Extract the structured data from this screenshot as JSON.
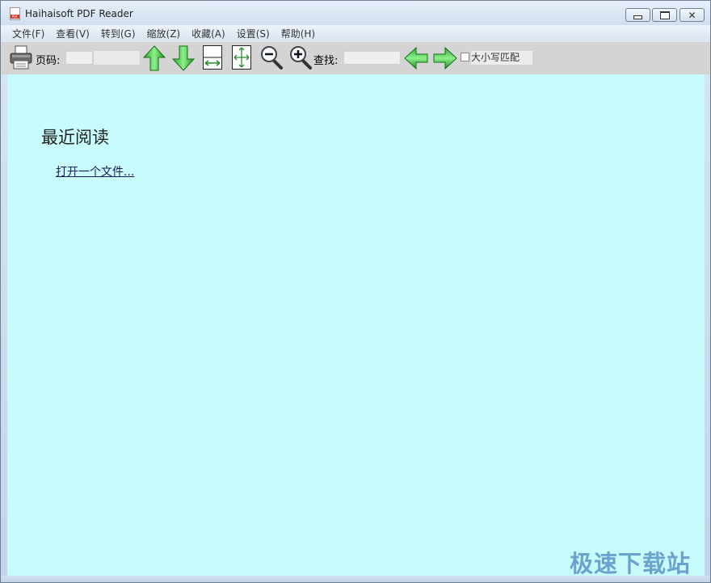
{
  "window": {
    "title": "Haihaisoft PDF Reader",
    "minimize_label": "",
    "maximize_label": "",
    "close_label": "✕"
  },
  "menu": {
    "items": [
      {
        "label": "文件(F)"
      },
      {
        "label": "查看(V)"
      },
      {
        "label": "转到(G)"
      },
      {
        "label": "缩放(Z)"
      },
      {
        "label": "收藏(A)"
      },
      {
        "label": "设置(S)"
      },
      {
        "label": "帮助(H)"
      }
    ]
  },
  "toolbar": {
    "page_label": "页码:",
    "page_value": "",
    "find_label": "查找:",
    "find_value": "",
    "case_match_label": "大小写匹配",
    "case_match_checked": false,
    "icons": [
      "printer-icon",
      "page-up-icon",
      "page-down-icon",
      "fit-width-icon",
      "fit-page-icon",
      "zoom-out-icon",
      "zoom-in-icon",
      "find-previous-icon",
      "find-next-icon"
    ]
  },
  "content": {
    "background": "#c8fbfb",
    "recent_title": "最近阅读",
    "open_file_link": "打开一个文件..."
  },
  "watermark": {
    "text": "极速下载站"
  }
}
